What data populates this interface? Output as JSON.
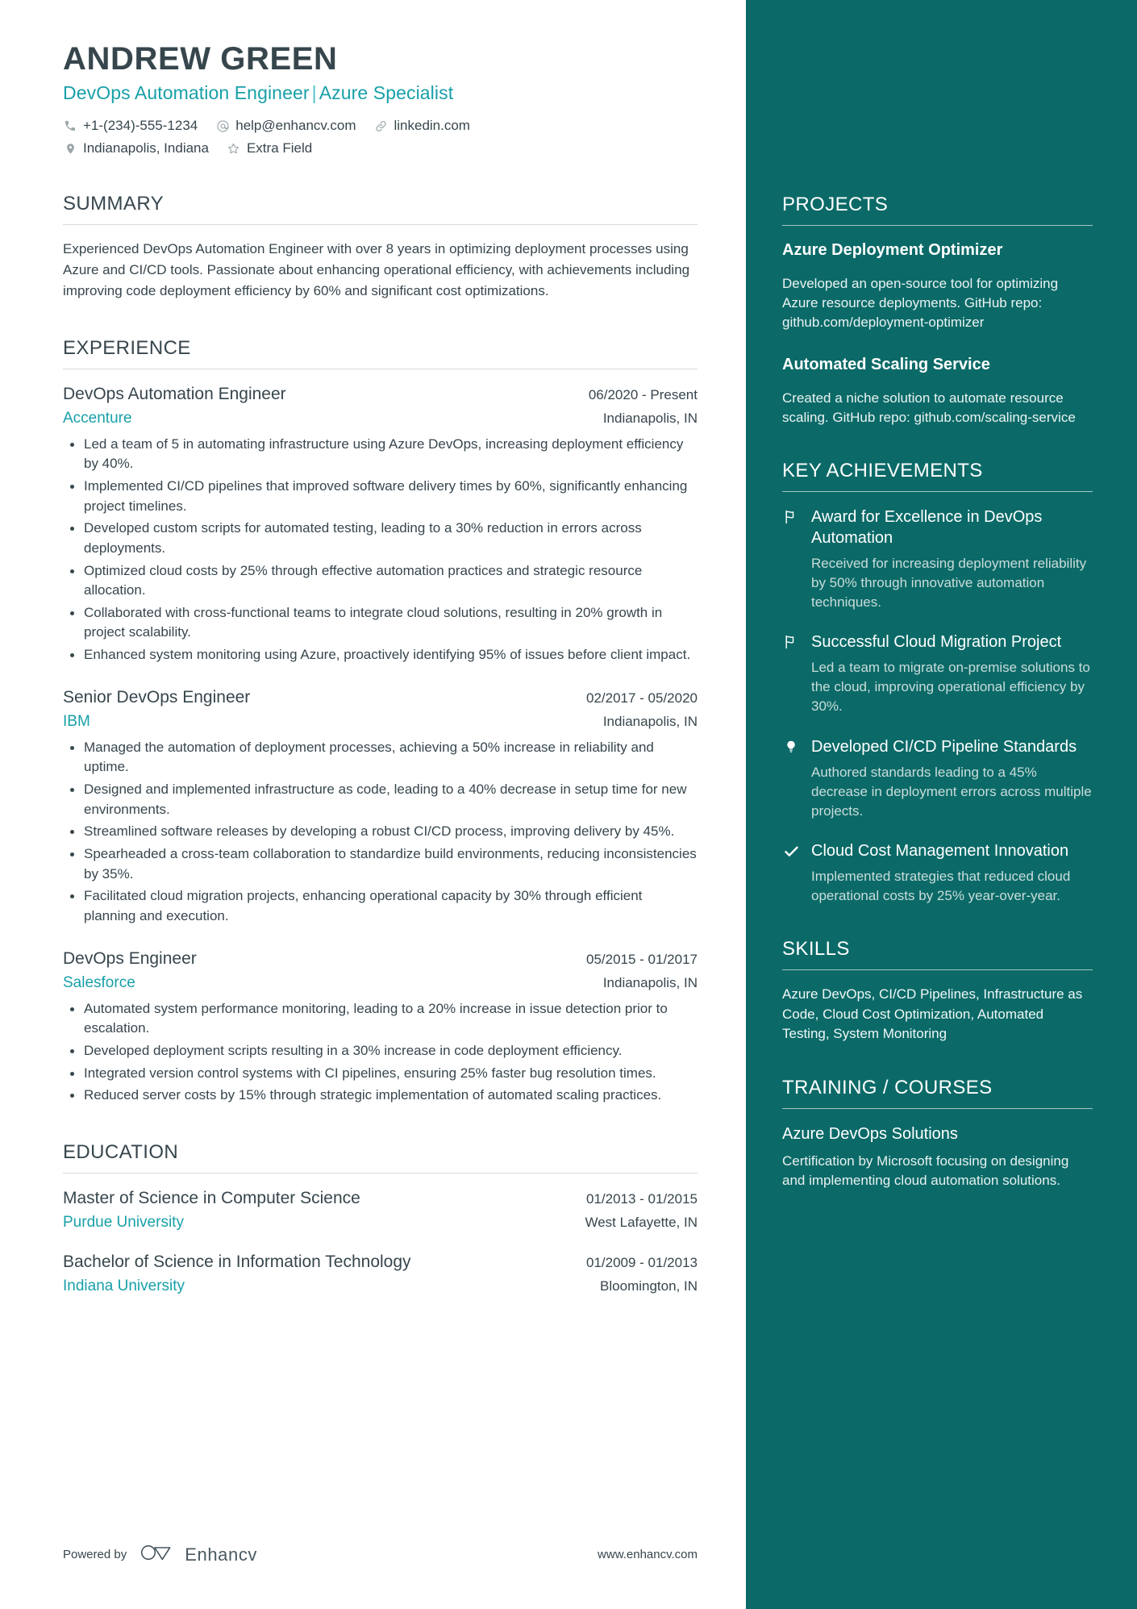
{
  "theme": {
    "sidebar_bg": "#0b6a68",
    "accent": "#18a0a8",
    "text": "#37464d"
  },
  "header": {
    "name": "ANDREW GREEN",
    "headline_left": "DevOps Automation Engineer",
    "headline_sep": "|",
    "headline_right": "Azure Specialist",
    "contacts_row1": [
      {
        "icon": "phone-icon",
        "text": "+1-(234)-555-1234"
      },
      {
        "icon": "email-icon",
        "text": "help@enhancv.com"
      },
      {
        "icon": "link-icon",
        "text": "linkedin.com"
      }
    ],
    "contacts_row2": [
      {
        "icon": "location-icon",
        "text": "Indianapolis, Indiana"
      },
      {
        "icon": "star-icon",
        "text": "Extra Field"
      }
    ]
  },
  "summary": {
    "title": "SUMMARY",
    "text": "Experienced DevOps Automation Engineer with over 8 years in optimizing deployment processes using Azure and CI/CD tools. Passionate about enhancing operational efficiency, with achievements including improving code deployment efficiency by 60% and significant cost optimizations."
  },
  "experience": {
    "title": "EXPERIENCE",
    "entries": [
      {
        "role": "DevOps Automation Engineer",
        "date": "06/2020 - Present",
        "company": "Accenture",
        "location": "Indianapolis, IN",
        "bullets": [
          "Led a team of 5 in automating infrastructure using Azure DevOps, increasing deployment efficiency by 40%.",
          "Implemented CI/CD pipelines that improved software delivery times by 60%, significantly enhancing project timelines.",
          "Developed custom scripts for automated testing, leading to a 30% reduction in errors across deployments.",
          "Optimized cloud costs by 25% through effective automation practices and strategic resource allocation.",
          "Collaborated with cross-functional teams to integrate cloud solutions, resulting in 20% growth in project scalability.",
          "Enhanced system monitoring using Azure, proactively identifying 95% of issues before client impact."
        ]
      },
      {
        "role": "Senior DevOps Engineer",
        "date": "02/2017 - 05/2020",
        "company": "IBM",
        "location": "Indianapolis, IN",
        "bullets": [
          "Managed the automation of deployment processes, achieving a 50% increase in reliability and uptime.",
          "Designed and implemented infrastructure as code, leading to a 40% decrease in setup time for new environments.",
          "Streamlined software releases by developing a robust CI/CD process, improving delivery by 45%.",
          "Spearheaded a cross-team collaboration to standardize build environments, reducing inconsistencies by 35%.",
          "Facilitated cloud migration projects, enhancing operational capacity by 30% through efficient planning and execution."
        ]
      },
      {
        "role": "DevOps Engineer",
        "date": "05/2015 - 01/2017",
        "company": "Salesforce",
        "location": "Indianapolis, IN",
        "bullets": [
          "Automated system performance monitoring, leading to a 20% increase in issue detection prior to escalation.",
          "Developed deployment scripts resulting in a 30% increase in code deployment efficiency.",
          "Integrated version control systems with CI pipelines, ensuring 25% faster bug resolution times.",
          "Reduced server costs by 15% through strategic implementation of automated scaling practices."
        ]
      }
    ]
  },
  "education": {
    "title": "EDUCATION",
    "entries": [
      {
        "degree": "Master of Science in Computer Science",
        "date": "01/2013 - 01/2015",
        "school": "Purdue University",
        "location": "West Lafayette, IN"
      },
      {
        "degree": "Bachelor of Science in Information Technology",
        "date": "01/2009 - 01/2013",
        "school": "Indiana University",
        "location": "Bloomington, IN"
      }
    ]
  },
  "footer": {
    "powered_by": "Powered by",
    "brand": "Enhancv",
    "url": "www.enhancv.com"
  },
  "sidebar": {
    "projects": {
      "title": "PROJECTS",
      "items": [
        {
          "name": "Azure Deployment Optimizer",
          "description": "Developed an open-source tool for optimizing Azure resource deployments. GitHub repo: github.com/deployment-optimizer"
        },
        {
          "name": "Automated Scaling Service",
          "description": "Created a niche solution to automate resource scaling. GitHub repo: github.com/scaling-service"
        }
      ]
    },
    "achievements": {
      "title": "KEY ACHIEVEMENTS",
      "items": [
        {
          "icon": "flag-icon",
          "name": "Award for Excellence in DevOps Automation",
          "description": "Received for increasing deployment reliability by 50% through innovative automation techniques."
        },
        {
          "icon": "flag-icon",
          "name": "Successful Cloud Migration Project",
          "description": "Led a team to migrate on-premise solutions to the cloud, improving operational efficiency by 30%."
        },
        {
          "icon": "lightbulb-icon",
          "name": "Developed CI/CD Pipeline Standards",
          "description": "Authored standards leading to a 45% decrease in deployment errors across multiple projects."
        },
        {
          "icon": "check-icon",
          "name": "Cloud Cost Management Innovation",
          "description": "Implemented strategies that reduced cloud operational costs by 25% year-over-year."
        }
      ]
    },
    "skills": {
      "title": "SKILLS",
      "text": "Azure DevOps, CI/CD Pipelines, Infrastructure as Code, Cloud Cost Optimization, Automated Testing, System Monitoring"
    },
    "training": {
      "title": "TRAINING / COURSES",
      "items": [
        {
          "name": "Azure DevOps Solutions",
          "description": "Certification by Microsoft focusing on designing and implementing cloud automation solutions."
        }
      ]
    }
  }
}
